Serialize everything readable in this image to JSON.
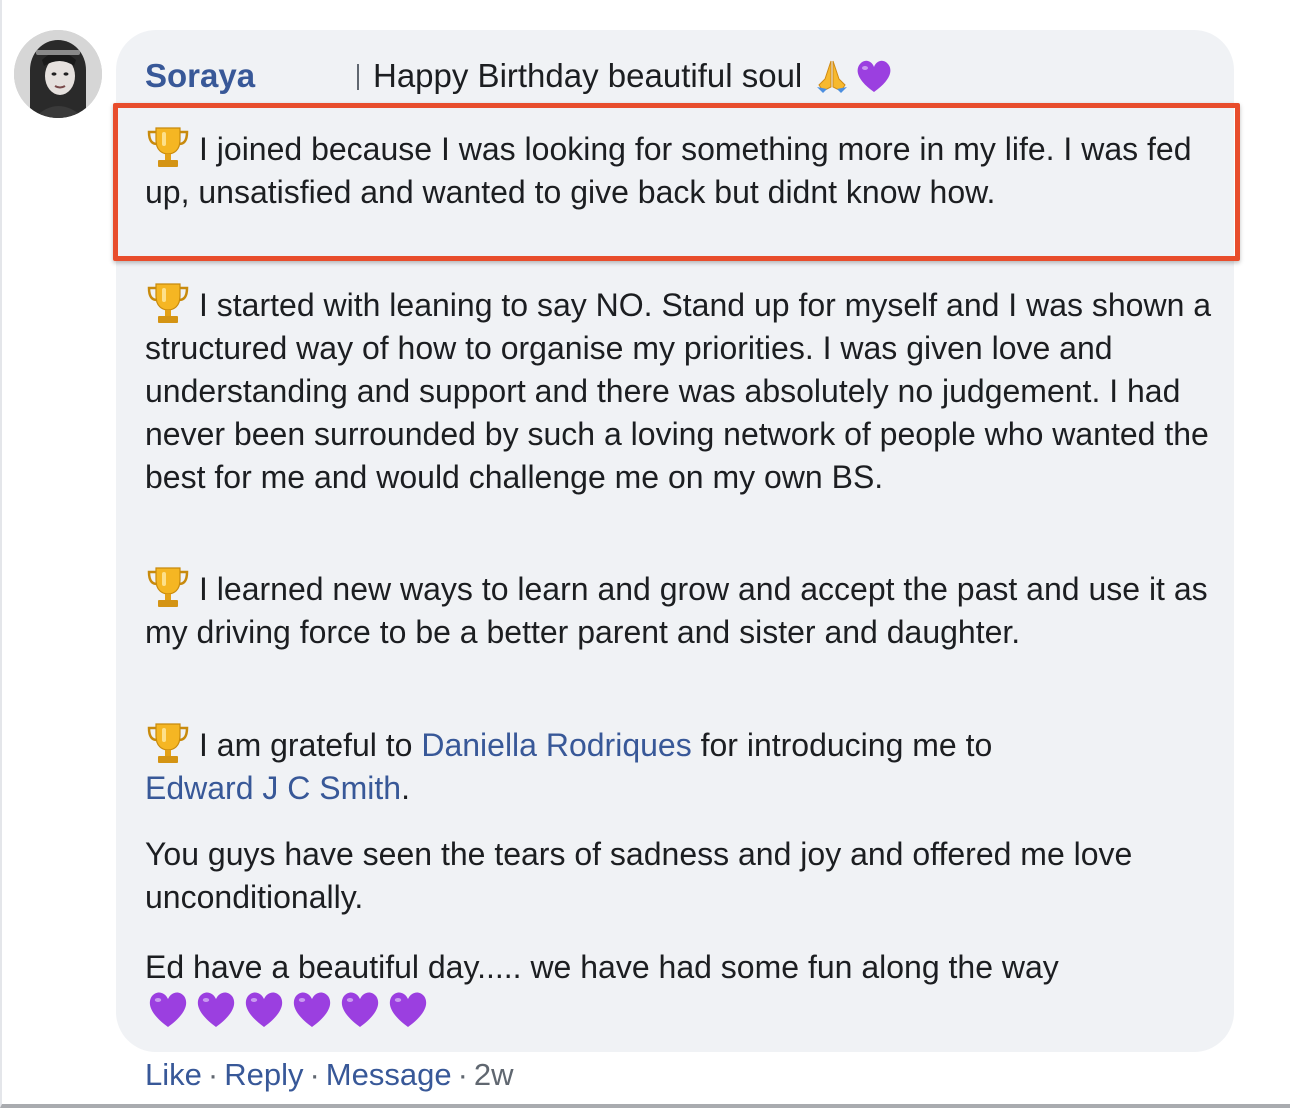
{
  "comment": {
    "author": "Soraya",
    "header_text": "Happy Birthday beautiful soul",
    "header_emojis": [
      "folded-hands-icon",
      "purple-heart-icon"
    ],
    "paragraphs": {
      "p1": "I joined because I was looking for something more in my life. I was fed up, unsatisfied and wanted to give back but didnt know how.",
      "p2": "I started with leaning to say NO. Stand up for myself and I was shown a structured way of how to organise my priorities. I was given love and understanding and support and there was absolutely no judgement. I had never been surrounded by such a loving network of people who wanted the best for me and would challenge me on my own BS.",
      "p3": "I learned new ways to learn and grow and accept the past and use it as my driving force to be a better parent and sister and daughter.",
      "p4_before": "I am grateful to",
      "p4_mention1": "Daniella Rodriques",
      "p4_middle": "for introducing me to",
      "p4_mention2": "Edward J C Smith",
      "p4_after": ".",
      "p5": "You guys have seen the tears of sadness and joy and offered me love unconditionally.",
      "p6": "Ed have a beautiful day..... we have had some fun along the way"
    },
    "paragraph_icon": "trophy-icon",
    "closing_emojis": [
      "purple-heart-icon",
      "purple-heart-icon",
      "purple-heart-icon",
      "purple-heart-icon",
      "purple-heart-icon",
      "purple-heart-icon"
    ]
  },
  "actions": {
    "like": "Like",
    "reply": "Reply",
    "message": "Message",
    "separator": "·",
    "time": "2w"
  },
  "colors": {
    "link": "#385898",
    "bubble": "#f0f2f5",
    "highlight": "#e84d2c",
    "heart": "#9b3fe0"
  }
}
